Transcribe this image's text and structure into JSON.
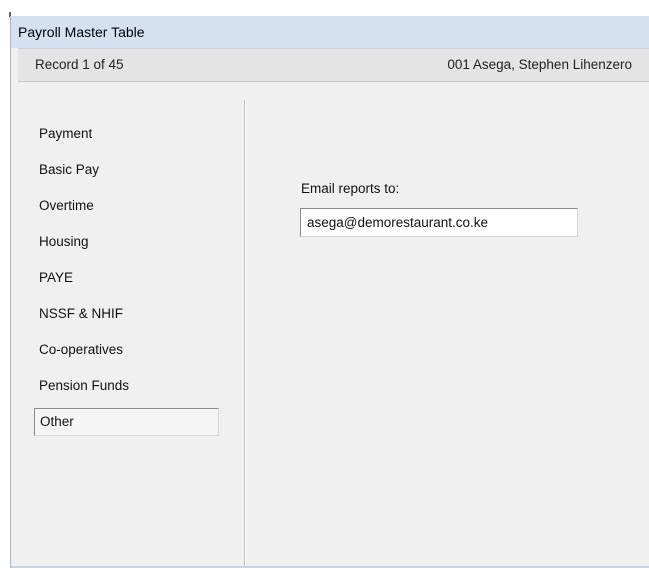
{
  "window": {
    "title": "Payroll Master Table"
  },
  "record_bar": {
    "record_count": "Record 1 of 45",
    "employee": "001  Asega, Stephen Lihenzero"
  },
  "sidebar": {
    "items": [
      {
        "label": "Payment",
        "selected": false
      },
      {
        "label": "Basic Pay",
        "selected": false
      },
      {
        "label": "Overtime",
        "selected": false
      },
      {
        "label": "Housing",
        "selected": false
      },
      {
        "label": "PAYE",
        "selected": false
      },
      {
        "label": "NSSF & NHIF",
        "selected": false
      },
      {
        "label": "Co-operatives",
        "selected": false
      },
      {
        "label": "Pension Funds",
        "selected": false
      },
      {
        "label": "Other",
        "selected": true
      }
    ]
  },
  "main": {
    "email_label": "Email reports to:",
    "email_value": "asega@demorestaurant.co.ke"
  },
  "colors": {
    "title_bar": "#d4e1f0",
    "window_bg": "#f0f0f0",
    "record_bar": "#e4e4e4"
  }
}
